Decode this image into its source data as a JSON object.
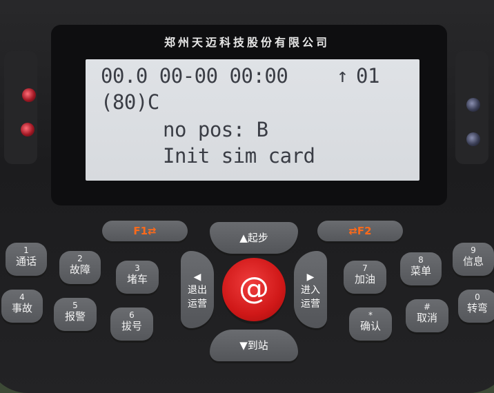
{
  "device": {
    "brand": "郑州天迈科技股份有限公司"
  },
  "display": {
    "line1": "00.0 00-00 00:00",
    "signal_arrow": "↑",
    "signal_value": "01",
    "line2": "(80)C",
    "line3": "no pos: B",
    "line4": "Init sim card"
  },
  "keys": {
    "f1": "F1⇄",
    "f2": "⇄F2",
    "up": {
      "symbol": "▲",
      "label": "起步"
    },
    "down": {
      "symbol": "▼",
      "label": "到站"
    },
    "left": {
      "symbol": "◀",
      "label1": "退出",
      "label2": "运营"
    },
    "right": {
      "symbol": "▶",
      "label1": "进入",
      "label2": "运营"
    },
    "center": "@",
    "k1": {
      "num": "1",
      "label": "通话"
    },
    "k2": {
      "num": "2",
      "label": "故障"
    },
    "k3": {
      "num": "3",
      "label": "堵车"
    },
    "k4": {
      "num": "4",
      "label": "事故"
    },
    "k5": {
      "num": "5",
      "label": "报警"
    },
    "k6": {
      "num": "6",
      "label": "拔号"
    },
    "k7": {
      "num": "7",
      "label": "加油"
    },
    "k8": {
      "num": "8",
      "label": "菜单"
    },
    "k9": {
      "num": "9",
      "label": "信息"
    },
    "kstar": {
      "num": "*",
      "label": "确认"
    },
    "khash": {
      "num": "#",
      "label": "取消"
    },
    "k0": {
      "num": "0",
      "label": "转弯"
    }
  }
}
